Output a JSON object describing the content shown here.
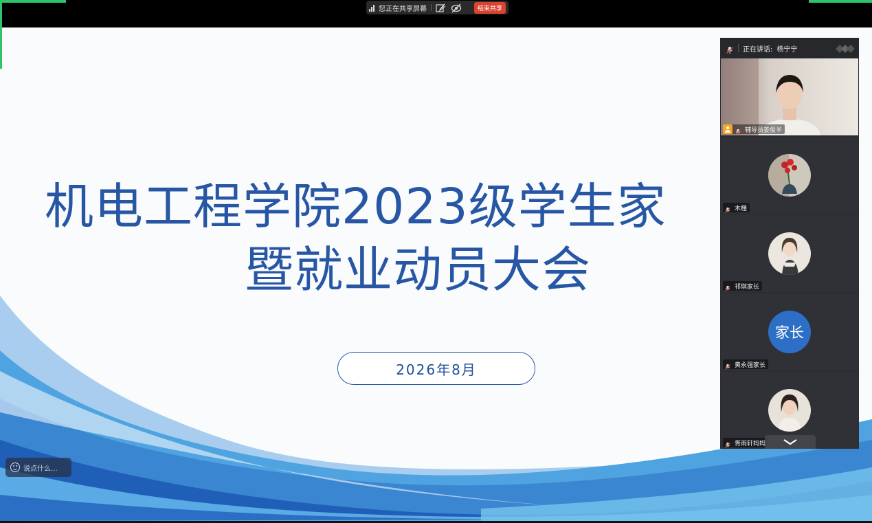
{
  "share_bar": {
    "status_text": "您正在共享屏幕",
    "end_share_label": "结束共享",
    "icons": [
      "signal-icon",
      "annotate-icon",
      "hide-icon"
    ]
  },
  "slide": {
    "title_line1": "机电工程学院2023级学生家",
    "title_line2": "暨就业动员大会",
    "date": "2026年8月"
  },
  "chat": {
    "placeholder": "说点什么..."
  },
  "video_panel": {
    "speaking_label": "正在讲话:",
    "speaking_name": "杨宁宁",
    "participants": [
      {
        "name": "辅导员姜俊羊",
        "role": "host",
        "video": "camera"
      },
      {
        "name": "木槿",
        "avatar": "flower-photo"
      },
      {
        "name": "祁琪家长",
        "avatar": "girl-photo"
      },
      {
        "name": "黄永强家长",
        "avatar_text": "家长"
      },
      {
        "name": "胥雨轩妈妈",
        "avatar": "woman-photo"
      }
    ]
  },
  "colors": {
    "title_blue": "#2757a4",
    "accent_green": "#2fc46b",
    "end_share_red": "#d9432f",
    "avatar_blue": "#2d6fc7"
  }
}
